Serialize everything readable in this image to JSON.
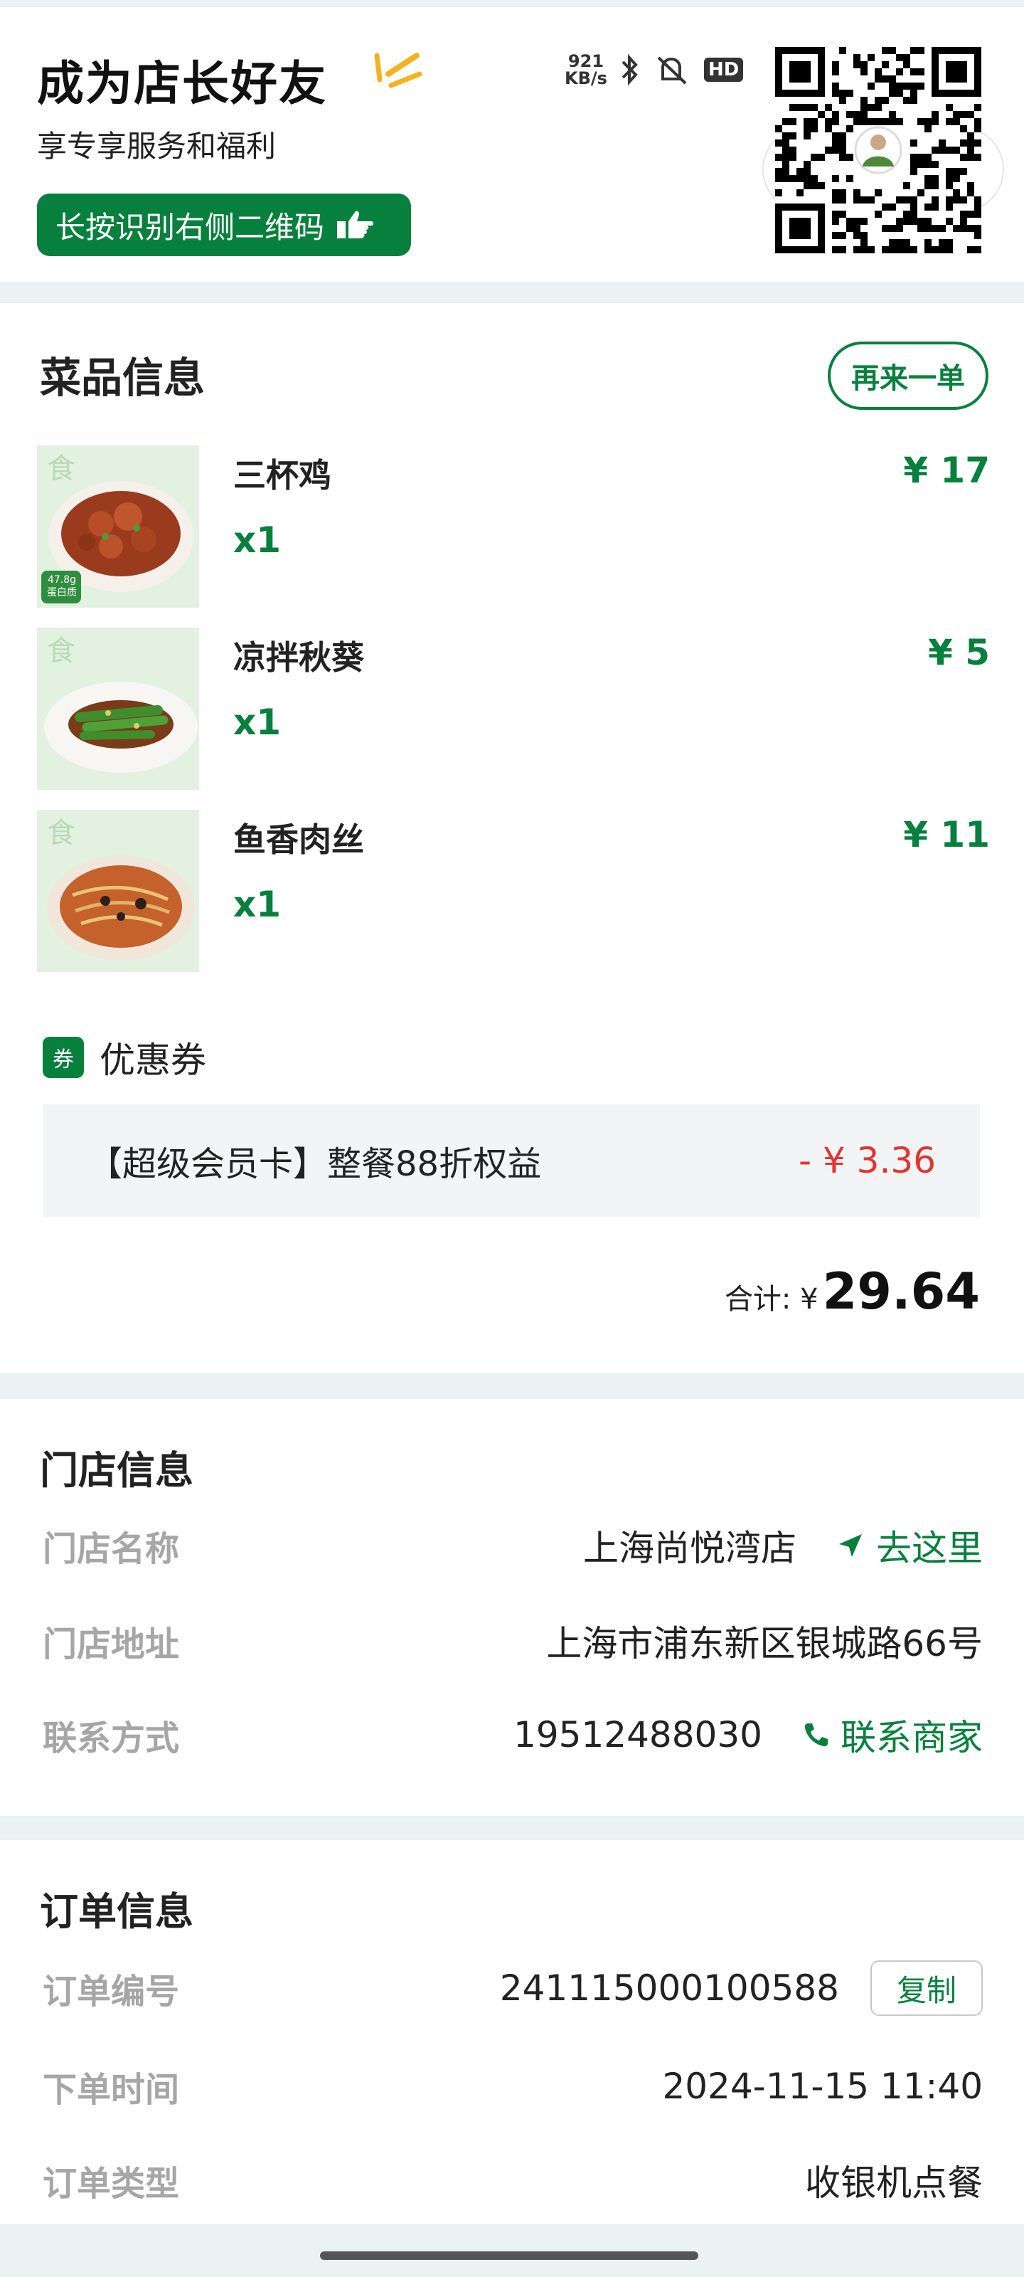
{
  "promo": {
    "title": "成为店长好友",
    "subtitle": "享专享服务和福利",
    "button_label": "长按识别右侧二维码",
    "status": {
      "speed": "921",
      "speed_unit": "KB/s",
      "hd": "HD"
    }
  },
  "dish_section": {
    "title": "菜品信息",
    "reorder_label": "再来一单",
    "items": [
      {
        "name": "三杯鸡",
        "qty": "x1",
        "price": "¥ 17",
        "badge": "47.8g 蛋白质"
      },
      {
        "name": "凉拌秋葵",
        "qty": "x1",
        "price": "¥ 5"
      },
      {
        "name": "鱼香肉丝",
        "qty": "x1",
        "price": "¥ 11"
      }
    ],
    "coupon": {
      "tag": "券",
      "label": "优惠券",
      "name": "【超级会员卡】整餐88折权益",
      "discount": "- ¥ 3.36"
    },
    "total_label": "合计: ¥",
    "total_value": "29.64"
  },
  "store_section": {
    "title": "门店信息",
    "name_key": "门店名称",
    "name_val": "上海尚悦湾店",
    "navigate_label": "去这里",
    "address_key": "门店地址",
    "address_val": "上海市浦东新区银城路66号",
    "contact_key": "联系方式",
    "contact_val": "19512488030",
    "contact_action": "联系商家"
  },
  "order_section": {
    "title": "订单信息",
    "number_key": "订单编号",
    "number_val": "241115000100588",
    "copy_label": "复制",
    "time_key": "下单时间",
    "time_val": "2024-11-15 11:40",
    "type_key": "订单类型",
    "type_val": "收银机点餐"
  },
  "colors": {
    "accent": "#07803e",
    "discount": "#e3342f",
    "background": "#eaf2f2"
  }
}
